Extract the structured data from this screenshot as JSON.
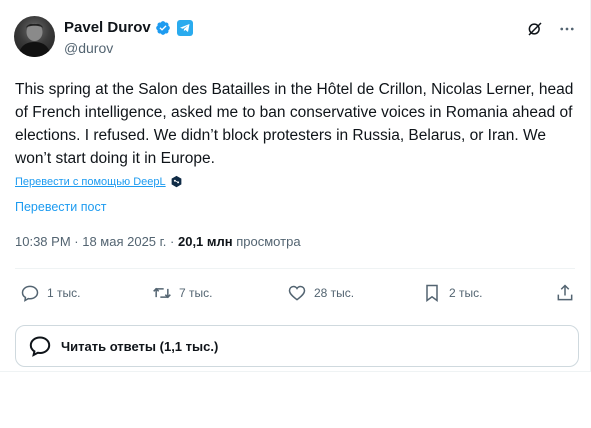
{
  "author": {
    "name": "Pavel Durov",
    "handle": "@durov"
  },
  "post": {
    "text": "This spring at the Salon des Batailles in the Hôtel de Crillon, Nicolas Lerner, head of French intelligence, asked me to ban conservative voices in Romania ahead of elections. I refused. We didn’t block protesters in Russia, Belarus, or Iran. We won’t start doing it in Europe.",
    "translate_deepl": "Перевести с помощью DeepL",
    "translate_post": "Перевести пост",
    "time": "10:38 PM",
    "date": "18 мая 2025 г.",
    "separator": " · ",
    "views_count": "20,1 млн",
    "views_label": "просмотра"
  },
  "actions": {
    "replies": "1 тыс.",
    "reposts": "7 тыс.",
    "likes": "28 тыс.",
    "bookmarks": "2 тыс."
  },
  "read_replies_label": "Читать ответы (1,1 тыс.)",
  "colors": {
    "accent": "#1d9bf0",
    "text": "#0f1419",
    "secondary": "#536471"
  }
}
